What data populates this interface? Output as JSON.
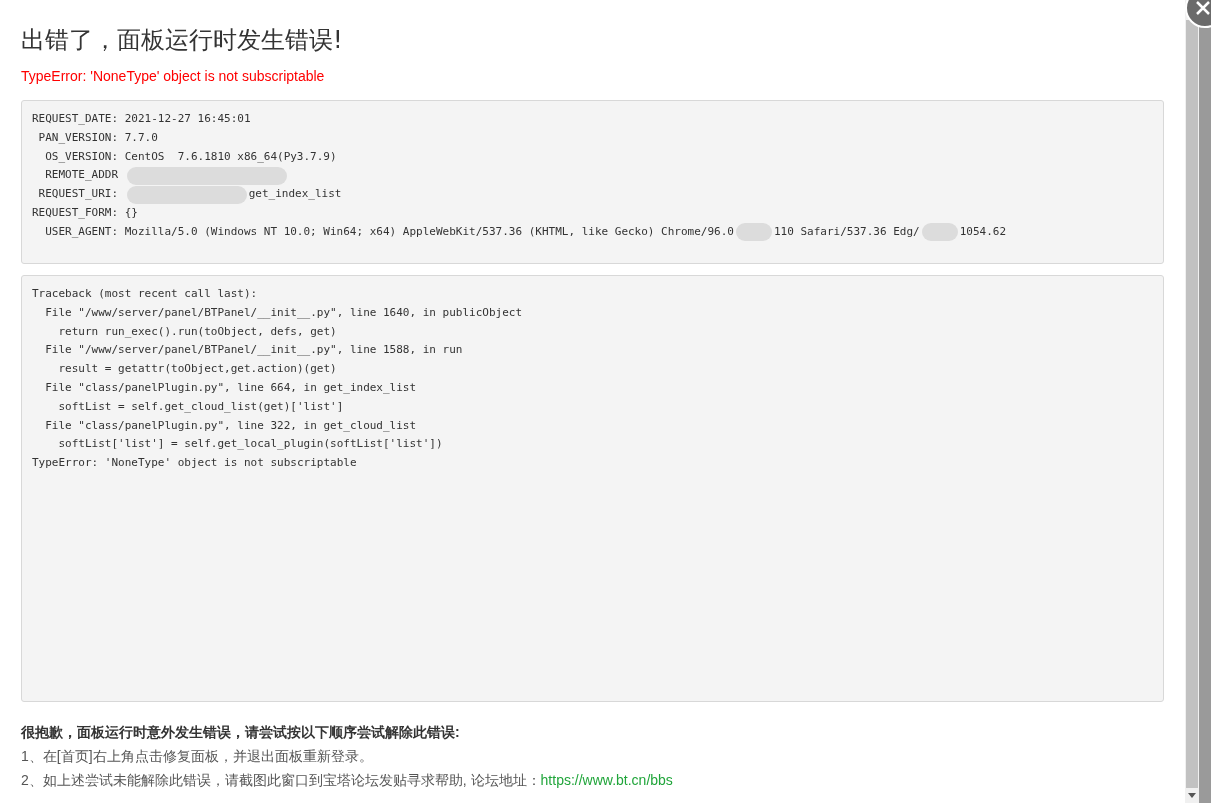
{
  "dialog": {
    "title": "出错了，面板运行时发生错误!",
    "error": "TypeError: 'NoneType' object is not subscriptable",
    "info_lines": [
      {
        "label": "REQUEST_DATE:",
        "parts": [
          "2021-12-27 16:45:01"
        ],
        "redacted_after_label": false
      },
      {
        "label": "PAN_VERSION:",
        "parts": [
          "7.7.0"
        ],
        "redacted_after_label": false
      },
      {
        "label": "OS_VERSION:",
        "parts": [
          "CentOS  7.6.1810 x86_64(Py3.7.9)"
        ],
        "redacted_after_label": false
      },
      {
        "label": "REMOTE_ADDR",
        "redacted_after_label": true
      },
      {
        "label": "REQUEST_URI:",
        "parts": [
          "get_index_list"
        ],
        "redacted_after_label": true
      },
      {
        "label": "REQUEST_FORM:",
        "parts": [
          "{}"
        ],
        "redacted_after_label": false
      },
      {
        "label": "USER_AGENT:",
        "parts": [
          "Mozilla/5.0 (Windows NT 10.0; Win64; x64) AppleWebKit/537.36 (KHTML, like Gecko) Chrome/96.0",
          "110 Safari/537.36 Edg/",
          "1054.62"
        ],
        "redacted_after_label": false
      }
    ],
    "traceback": [
      "Traceback (most recent call last):",
      "  File \"/www/server/panel/BTPanel/__init__.py\", line 1640, in publicObject",
      "    return run_exec().run(toObject, defs, get)",
      "  File \"/www/server/panel/BTPanel/__init__.py\", line 1588, in run",
      "    result = getattr(toObject,get.action)(get)",
      "  File \"class/panelPlugin.py\", line 664, in get_index_list",
      "    softList = self.get_cloud_list(get)['list']",
      "  File \"class/panelPlugin.py\", line 322, in get_cloud_list",
      "    softList['list'] = self.get_local_plugin(softList['list'])",
      "TypeError: 'NoneType' object is not subscriptable"
    ],
    "help_title": "很抱歉，面板运行时意外发生错误，请尝试按以下顺序尝试解除此错误:",
    "help_steps": [
      {
        "text": "1、在[首页]右上角点击修复面板，并退出面板重新登录。"
      },
      {
        "text": "2、如上述尝试未能解除此错误，请截图此窗口到宝塔论坛发贴寻求帮助, 论坛地址：",
        "link": "https://www.bt.cn/bbs"
      }
    ]
  }
}
